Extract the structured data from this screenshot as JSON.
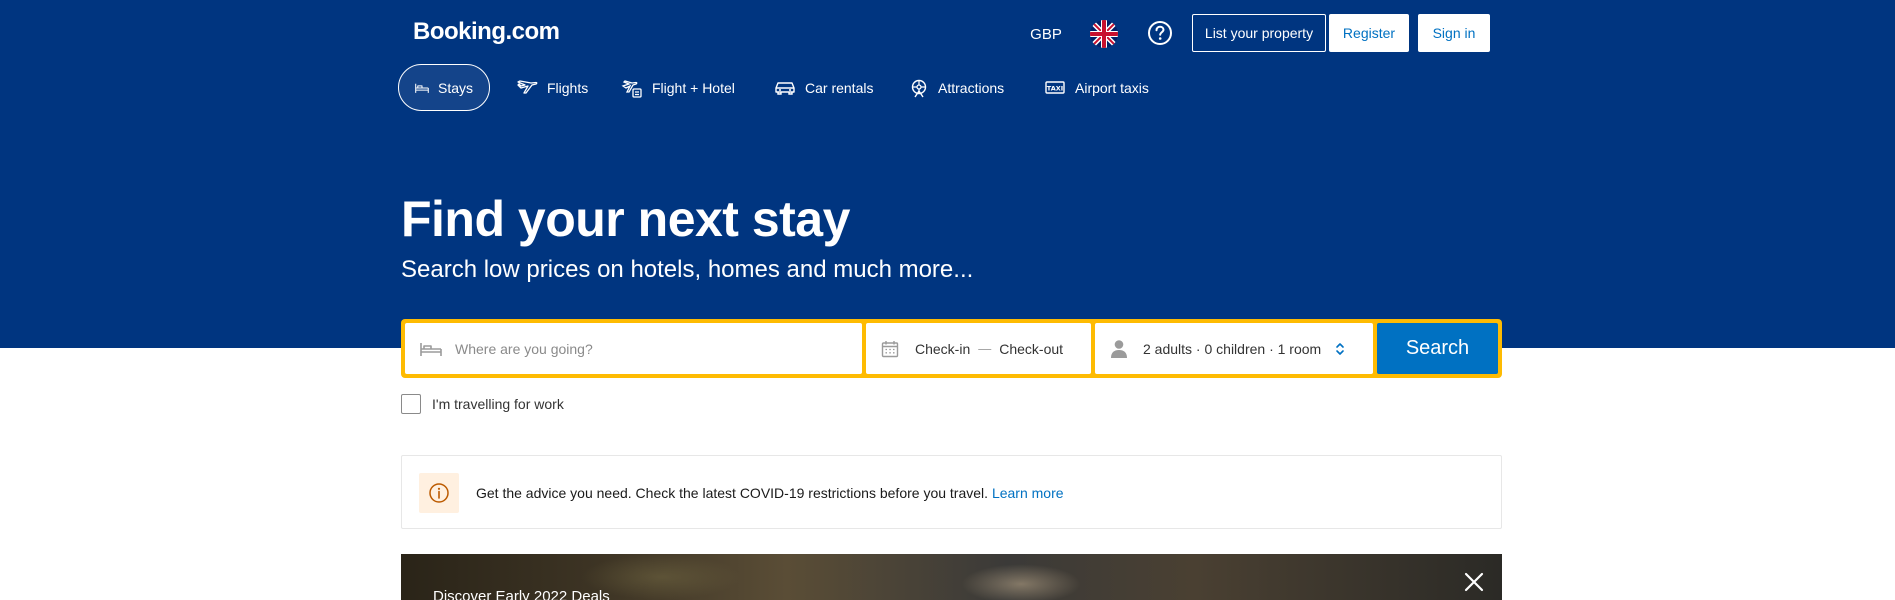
{
  "header": {
    "logo": "Booking.com",
    "currency": "GBP",
    "language_icon": "uk-flag-icon",
    "help_icon": "question-circle-icon",
    "list_property": "List your property",
    "register": "Register",
    "sign_in": "Sign in"
  },
  "nav": {
    "items": [
      {
        "label": "Stays",
        "icon": "bed-icon",
        "active": true
      },
      {
        "label": "Flights",
        "icon": "plane-icon",
        "active": false
      },
      {
        "label": "Flight + Hotel",
        "icon": "flight-hotel-icon",
        "active": false
      },
      {
        "label": "Car rentals",
        "icon": "car-icon",
        "active": false
      },
      {
        "label": "Attractions",
        "icon": "attractions-icon",
        "active": false
      },
      {
        "label": "Airport taxis",
        "icon": "taxi-icon",
        "active": false
      }
    ]
  },
  "hero": {
    "title": "Find your next stay",
    "subtitle": "Search low prices on hotels, homes and much more..."
  },
  "search": {
    "destination_placeholder": "Where are you going?",
    "check_in": "Check-in",
    "dates_separator": "—",
    "check_out": "Check-out",
    "guests": "2 adults · 0 children · 1 room",
    "button": "Search"
  },
  "work_travel": {
    "label": "I'm travelling for work",
    "checked": false
  },
  "notice": {
    "text": "Get the advice you need. Check the latest COVID-19 restrictions before you travel.",
    "link": "Learn more"
  },
  "promo": {
    "text": "Discover Early 2022 Deals"
  },
  "colors": {
    "brand_blue": "#003580",
    "action_blue": "#0071c2",
    "search_border": "#febb02"
  }
}
